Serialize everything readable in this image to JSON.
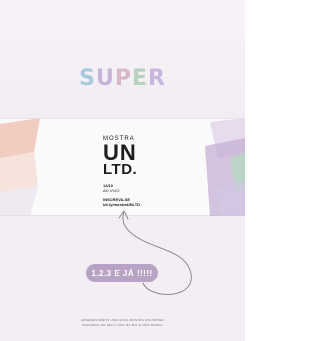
{
  "header": {
    "title_letters": [
      {
        "char": "S",
        "color": "#a6c9dc"
      },
      {
        "char": "U",
        "color": "#c5b3d8"
      },
      {
        "char": "P",
        "color": "#d8b7c9"
      },
      {
        "char": "E",
        "color": "#b7d3c0"
      },
      {
        "char": "R",
        "color": "#c8b6dd"
      }
    ]
  },
  "poster": {
    "mostra": "MOSTRA",
    "un": "UN",
    "ltd": "LTD.",
    "date": "14/10",
    "live": "AO VIVO",
    "cta": "INSCREVA-SE",
    "link": "bit.ly/mostraUNLTD"
  },
  "cta_pill": {
    "label": "1.2.3 E JÁ !!!!!",
    "color": "#b9a3c4"
  },
  "footer": {
    "line1": "APRESENTAMOS UMA NOVA MOSTRA UNLIMITED",
    "line2": "INSCREVA-SE PELO LINK NA BIO E NÃO PERCA"
  }
}
